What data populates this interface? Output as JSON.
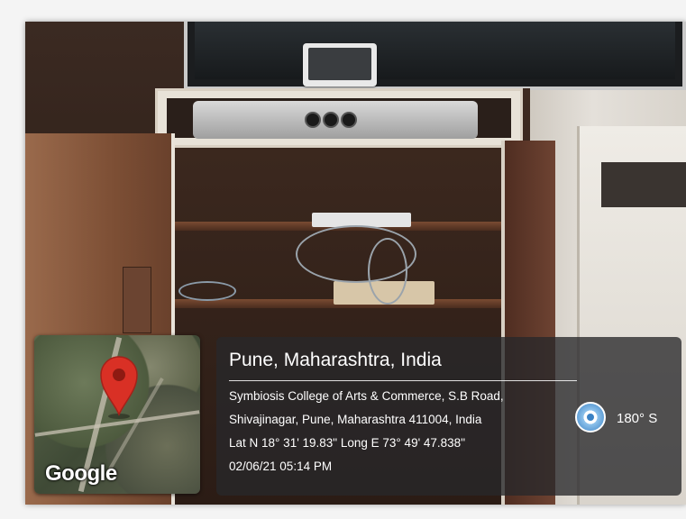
{
  "overlay": {
    "location_title": "Pune, Maharashtra, India",
    "address_line_1": "Symbiosis College of Arts & Commerce, S.B Road,",
    "address_line_2": "Shivajinagar, Pune, Maharashtra 411004, India",
    "coordinates": "Lat N 18° 31' 19.83\" Long E 73° 49' 47.838\"",
    "datetime": "02/06/21 05:14 PM",
    "heading": "180° S",
    "map_logo": "Google"
  },
  "icons": {
    "map_pin": "map-pin-icon",
    "compass": "compass-icon"
  },
  "colors": {
    "pin": "#d93025",
    "compass": "#3b82c4",
    "panel": "rgba(40,40,42,0.78)"
  }
}
